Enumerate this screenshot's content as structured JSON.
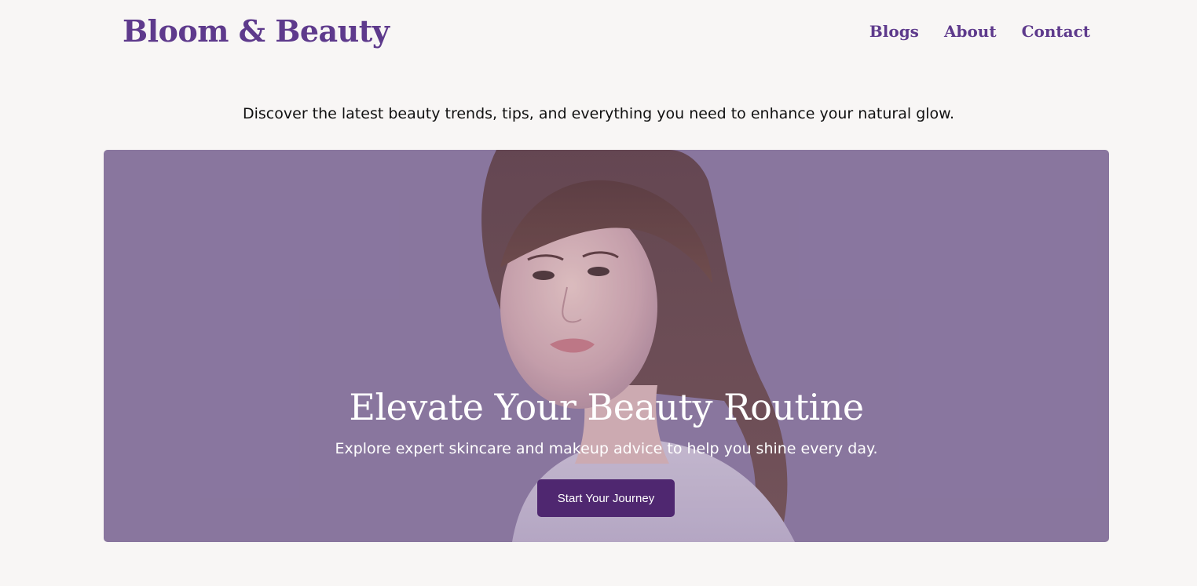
{
  "header": {
    "brand": "Bloom & Beauty",
    "nav": [
      "Blogs",
      "About",
      "Contact"
    ]
  },
  "tagline": "Discover the latest beauty trends, tips, and everything you need to enhance your natural glow.",
  "hero": {
    "title": "Elevate Your Beauty Routine",
    "subtitle": "Explore expert skincare and makeup advice to help you shine every day.",
    "cta_label": "Start Your Journey"
  },
  "colors": {
    "brand": "#5e3a8c",
    "background": "#f8f6f5",
    "hero_overlay": "#8b79a0",
    "cta": "#4f2770"
  }
}
